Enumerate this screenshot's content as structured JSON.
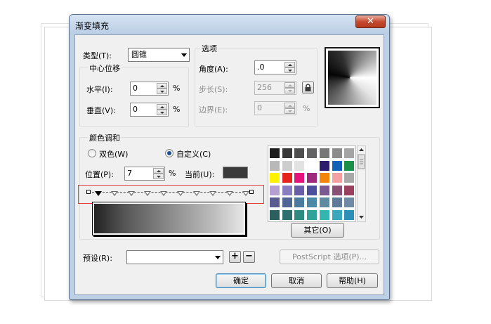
{
  "dialog": {
    "title": "渐变填充",
    "close_label": "✕"
  },
  "type": {
    "label": "类型(T):",
    "value": "圆锥"
  },
  "center_offset": {
    "group_label": "中心位移",
    "horizontal_label": "水平(I):",
    "horizontal_value": "0",
    "horizontal_unit": "%",
    "vertical_label": "垂直(V):",
    "vertical_value": "0",
    "vertical_unit": "%"
  },
  "options": {
    "group_label": "选项",
    "angle_label": "角度(A):",
    "angle_value": ".0",
    "steps_label": "步长(S):",
    "steps_value": "256",
    "edge_label": "边界(E):",
    "edge_value": "0",
    "edge_unit": "%",
    "lock_icon": "lock-icon"
  },
  "color_blend": {
    "group_label": "颜色调和",
    "two_color_label": "双色(W)",
    "custom_label": "自定义(C)",
    "selected": "custom",
    "position_label": "位置(P):",
    "position_value": "7",
    "position_unit": "%",
    "current_label": "当前(U):",
    "current_color": "#3a3a3a",
    "marker_count": 10,
    "other_button": "其它(O)"
  },
  "palette": {
    "colors": [
      [
        "#1e1e1e",
        "#383838",
        "#4e4e4e",
        "#636363",
        "#777777",
        "#8c8c8c",
        "#a4a4a4"
      ],
      [
        "#b8b8b8",
        "#cdcdcd",
        "#e2e2e2",
        "#ffffff",
        "#2d1c6b",
        "#1560b8",
        "#1a9149"
      ],
      [
        "#fff200",
        "#e5241b",
        "#e4147c",
        "#9d2a7e",
        "#f2850c",
        "#f2a0a0",
        "#a8a8a8"
      ],
      [
        "#b59fd1",
        "#8a7cc0",
        "#6a5ea8",
        "#4b4f9c",
        "#7b5a91",
        "#8a5074",
        "#9a3f5e"
      ],
      [
        "#585c90",
        "#4f6595",
        "#4a7ba1",
        "#4a8aa8",
        "#5f8aa0",
        "#5e7c98",
        "#6e8aa4"
      ],
      [
        "#2e5f5f",
        "#2d6f6c",
        "#2f8a82",
        "#2fa39a",
        "#34b5b0",
        "#3aa7bd",
        "#2d8fb8"
      ]
    ]
  },
  "preset": {
    "label": "预设(R):",
    "value": "",
    "add_label": "+",
    "remove_label": "−"
  },
  "postscript_button": "PostScript 选项(P)...",
  "buttons": {
    "ok": "确定",
    "cancel": "取消",
    "help": "帮助(H)"
  }
}
